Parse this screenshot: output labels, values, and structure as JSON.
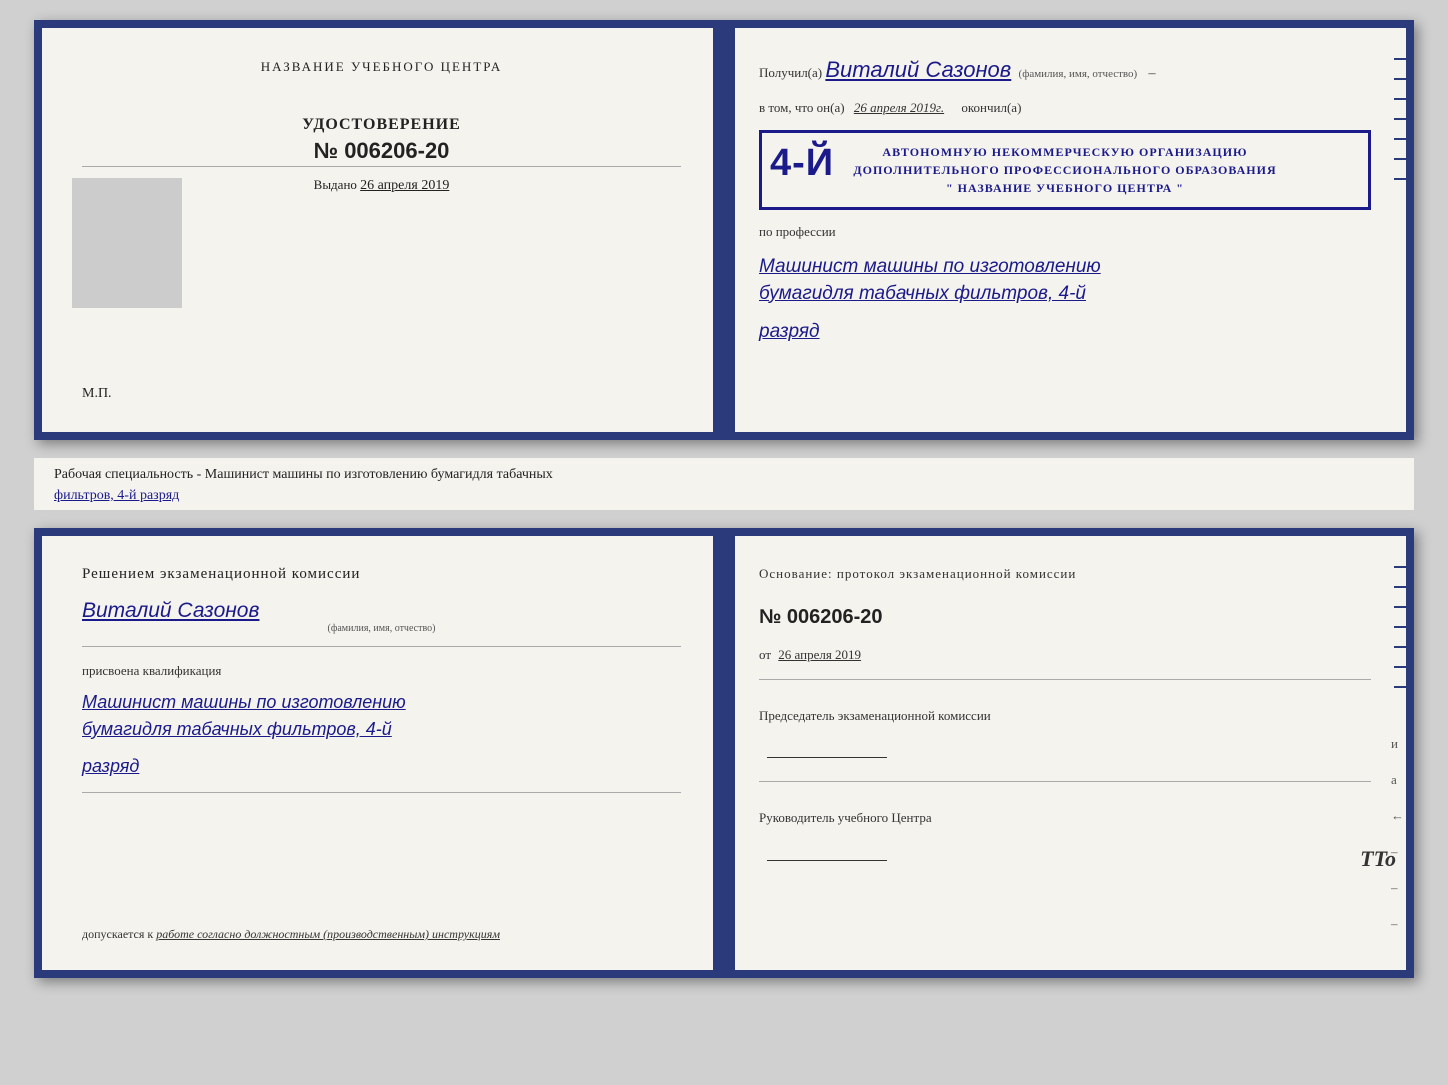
{
  "top_left": {
    "title": "НАЗВАНИЕ УЧЕБНОГО ЦЕНТРА",
    "cert_label": "УДОСТОВЕРЕНИЕ",
    "cert_number": "№ 006206-20",
    "issued_label": "Выдано",
    "issued_date": "26 апреля 2019",
    "mp_label": "М.П."
  },
  "top_right": {
    "poluchil_prefix": "Получил(а)",
    "recipient_name": "Виталий Сазонов",
    "recipient_subtext": "(фамилия, имя, отчество)",
    "vtom_prefix": "в том, что он(а)",
    "vtom_date": "26 апреля 2019г.",
    "okonchill": "окончил(а)",
    "org_number": "4-й",
    "org_line1": "АВТОНОМНУЮ НЕКОММЕРЧЕСКУЮ ОРГАНИЗАЦИЮ",
    "org_line2": "ДОПОЛНИТЕЛЬНОГО ПРОФЕССИОНАЛЬНОГО ОБРАЗОВАНИЯ",
    "org_line3": "\" НАЗВАНИЕ УЧЕБНОГО ЦЕНТРА \"",
    "profession_label": "по профессии",
    "profession_line1": "Машинист машины по изготовлению",
    "profession_line2": "бумагидля табачных фильтров, 4-й",
    "razryad": "разряд"
  },
  "subtitle": {
    "text_prefix": "Рабочая специальность - Машинист машины по изготовлению бумагидля табачных",
    "text_underline": "фильтров, 4-й разряд"
  },
  "bottom_left": {
    "komissia_title": "Решением  экзаменационной  комиссии",
    "name": "Виталий Сазонов",
    "name_subtext": "(фамилия, имя, отчество)",
    "prisvoena_label": "присвоена квалификация",
    "kval_line1": "Машинист машины по изготовлению",
    "kval_line2": "бумагидля табачных фильтров, 4-й",
    "kval_line3": "разряд",
    "dopuskaetsya_prefix": "допускается к",
    "dopuskaetsya_value": "работе согласно должностным (производственным) инструкциям"
  },
  "bottom_right": {
    "osnovaniye_text": "Основание: протокол экзаменационной  комиссии",
    "protocol_number": "№  006206-20",
    "ot_label": "от",
    "ot_date": "26 апреля 2019",
    "predsedatel_label": "Председатель экзаменационной комиссии",
    "rukovoditel_label": "Руководитель учебного Центра"
  },
  "tto_mark": "TTo"
}
